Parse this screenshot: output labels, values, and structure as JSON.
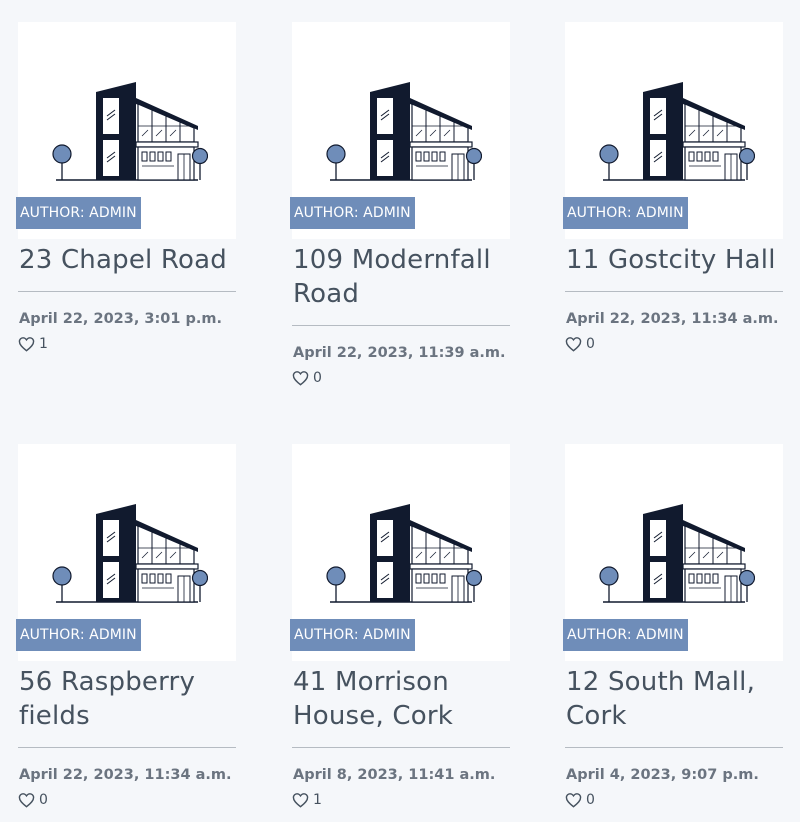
{
  "listings": [
    {
      "title": "23 Chapel Road",
      "author": "AUTHOR: ADMIN",
      "date": "April 22, 2023, 3:01 p.m.",
      "likes": "1"
    },
    {
      "title": "109 Modernfall Road",
      "author": "AUTHOR: ADMIN",
      "date": "April 22, 2023, 11:39 a.m.",
      "likes": "0"
    },
    {
      "title": "11 Gostcity Hall",
      "author": "AUTHOR: ADMIN",
      "date": "April 22, 2023, 11:34 a.m.",
      "likes": "0"
    },
    {
      "title": "56 Raspberry fields",
      "author": "AUTHOR: ADMIN",
      "date": "April 22, 2023, 11:34 a.m.",
      "likes": "0"
    },
    {
      "title": "41 Morrison House, Cork",
      "author": "AUTHOR: ADMIN",
      "date": "April 8, 2023, 11:41 a.m.",
      "likes": "1"
    },
    {
      "title": "12 South Mall, Cork",
      "author": "AUTHOR: ADMIN",
      "date": "April 4, 2023, 9:07 p.m.",
      "likes": "0"
    }
  ],
  "icons": {
    "thumbnail": "house-illustration",
    "like": "heart-icon"
  },
  "colors": {
    "badge": "#6f8db9",
    "building_dark": "#111a2e",
    "tree": "#6f8db9"
  }
}
